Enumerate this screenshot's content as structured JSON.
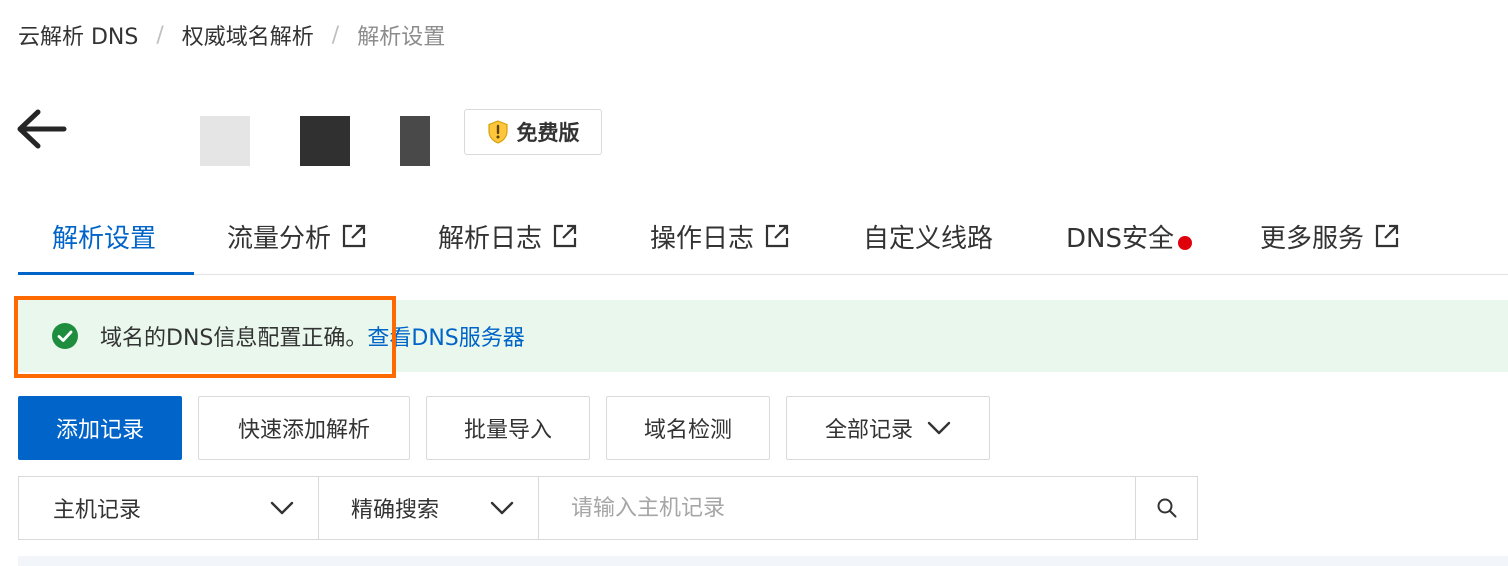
{
  "breadcrumb": [
    "云解析 DNS",
    "权威域名解析",
    "解析设置"
  ],
  "header": {
    "edition_label": "免费版"
  },
  "tabs": [
    {
      "label": "解析设置",
      "external": false,
      "active": true
    },
    {
      "label": "流量分析",
      "external": true
    },
    {
      "label": "解析日志",
      "external": true
    },
    {
      "label": "操作日志",
      "external": true
    },
    {
      "label": "自定义线路",
      "external": false
    },
    {
      "label": "DNS安全",
      "external": false,
      "red_dot": true
    },
    {
      "label": "更多服务",
      "external": true
    }
  ],
  "alert": {
    "text": "域名的DNS信息配置正确。",
    "link": "查看DNS服务器",
    "icon": "check-circle-icon",
    "color": "#1e8e3e",
    "background": "#e9f7ec"
  },
  "toolbar": {
    "add_record": "添加记录",
    "quick_add": "快速添加解析",
    "batch_import": "批量导入",
    "domain_check": "域名检测",
    "all_records": "全部记录"
  },
  "search": {
    "field": "主机记录",
    "mode": "精确搜索",
    "placeholder": "请输入主机记录"
  },
  "colors": {
    "primary": "#0064c8",
    "highlight_border": "#ff6a00",
    "alert_dot": "#e0000c",
    "badge_shield": "#ffc53d"
  }
}
